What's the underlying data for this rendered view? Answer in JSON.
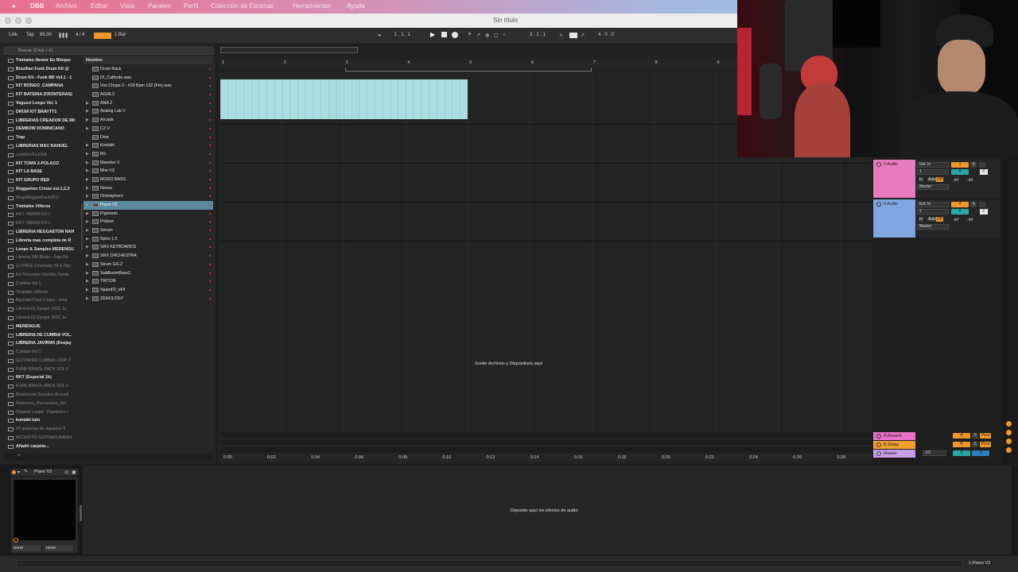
{
  "menubar": {
    "items": [
      "Archivo",
      "Editar",
      "Vista",
      "Paneles",
      "Perfil",
      "Colección de Escenas",
      "Herramientas",
      "Ayuda"
    ]
  },
  "window": {
    "title": "Sin título"
  },
  "transport": {
    "link": "Link",
    "tap": "Tap",
    "tempo": "85.00",
    "time_sig": "4 / 4",
    "quantize": "1 Bar",
    "position": "1 .   1 .   1",
    "loop_start": "3 .   1 .   1",
    "loop_length": "4 .   0 .   0"
  },
  "browser": {
    "search_placeholder": "Buscar (Cmd + F)",
    "sidebar": [
      {
        "label": "Timbales Nestor En Bloque",
        "dim": false
      },
      {
        "label": "Brazilian Funk Drum Kit @",
        "dim": false
      },
      {
        "label": "Drum Kit - Funk BR Vol.1 - 1",
        "dim": false
      },
      {
        "label": "KIT BONGO_CAMPANA",
        "dim": false
      },
      {
        "label": "KIT BATERIA (FRONTERAS)",
        "dim": false
      },
      {
        "label": "Veguzzi Loops Vol. 1",
        "dim": false
      },
      {
        "label": "DRUM KIT BRAYTT1",
        "dim": false
      },
      {
        "label": "LIBRERIAS CREADOR DE RK",
        "dim": false
      },
      {
        "label": "DEMBOW DOMINICANO",
        "dim": false
      },
      {
        "label": "Trap",
        "dim": false
      },
      {
        "label": "LIBRERIAS MAC NAHUEL",
        "dim": false
      },
      {
        "label": "cumbiaVILLERA",
        "dim": true
      },
      {
        "label": "KIT TOMA 2-POLACO",
        "dim": false
      },
      {
        "label": "KIT LA BASE",
        "dim": false
      },
      {
        "label": "KIT GRUPO RED",
        "dim": false
      },
      {
        "label": "Reggaeton Crivas vol.1,2,3",
        "dim": false
      },
      {
        "label": "MegaReggaePack2017",
        "dim": true
      },
      {
        "label": "Timbales Villeros",
        "dim": false
      },
      {
        "label": "RKT -REMIX-DJ-1",
        "dim": true
      },
      {
        "label": "RKT -REMIX-DJ-1",
        "dim": true
      },
      {
        "label": "LIBRERIA REGGAETON NAH",
        "dim": false
      },
      {
        "label": "Libreria mas completa de R",
        "dim": false
      },
      {
        "label": "Loops & Samples MERENGU",
        "dim": false
      },
      {
        "label": "Libreria 188 Beats - Rap-Bo",
        "dim": true
      },
      {
        "label": "12 FREE Cinematic SFX Opc",
        "dim": true
      },
      {
        "label": "Kit Percusion Cumbia Santa",
        "dim": true
      },
      {
        "label": "Cumbia Vol 1",
        "dim": true
      },
      {
        "label": "Timbales Villeros",
        "dim": true
      },
      {
        "label": "Bachata Pack Loops - Joris",
        "dim": true
      },
      {
        "label": "Libreria Dj Danger 2021 Ju",
        "dim": true
      },
      {
        "label": "Libreria Dj Danger 2021 Ju",
        "dim": true
      },
      {
        "label": "MERENGUE",
        "dim": false
      },
      {
        "label": "LIBRERIA DE CUMBIA VOL.",
        "dim": false
      },
      {
        "label": "LIBRERIA JAVIRMX (Deejay",
        "dim": false
      },
      {
        "label": "Cumbia Vol 1",
        "dim": true
      },
      {
        "label": "GUITARRA CUMBIA LOOP 2",
        "dim": true
      },
      {
        "label": "FUNK BRAZIL PACK VOL II",
        "dim": true
      },
      {
        "label": "RKT (Especial 1k)",
        "dim": false
      },
      {
        "label": "FUNK BRAZIL PACK VOL II",
        "dim": true
      },
      {
        "label": "Blackwood Samples Acousti",
        "dim": true
      },
      {
        "label": "Flamenco_Percussion_Vol.",
        "dim": true
      },
      {
        "label": "Organic Loops - Flamenco I",
        "dim": true
      },
      {
        "label": "kontakt tuto",
        "dim": false
      },
      {
        "label": "02 guitarras de regaeton 9",
        "dim": true
      },
      {
        "label": "ACOUSTIC-GUITARS-BANDI",
        "dim": true
      },
      {
        "label": "Añadir carpeta...",
        "dim": false
      }
    ],
    "content_header": "Nombre",
    "content": [
      {
        "label": "Drum Rack",
        "arrow": false,
        "dot": false
      },
      {
        "label": "DI_Cathode.wav",
        "arrow": false,
        "dot": false
      },
      {
        "label": "Vox Chops 2 - #29 Bpm 132 (Fm).wav",
        "arrow": false,
        "dot": false
      },
      {
        "label": "AGML2",
        "arrow": false,
        "dot": false
      },
      {
        "label": "ANA 2",
        "arrow": true,
        "dot": false
      },
      {
        "label": "Analog Lab V",
        "arrow": true,
        "dot": false
      },
      {
        "label": "Arcade",
        "arrow": true,
        "dot": false
      },
      {
        "label": "CZ V",
        "arrow": true,
        "dot": false
      },
      {
        "label": "Diva",
        "arrow": false,
        "dot": false
      },
      {
        "label": "Kontakt",
        "arrow": true,
        "dot": false
      },
      {
        "label": "M1",
        "arrow": true,
        "dot": false
      },
      {
        "label": "Massive X",
        "arrow": true,
        "dot": false
      },
      {
        "label": "Mini V3",
        "arrow": true,
        "dot": false
      },
      {
        "label": "MODO BASS",
        "arrow": true,
        "dot": false
      },
      {
        "label": "Nexus",
        "arrow": true,
        "dot": false
      },
      {
        "label": "Omnisphere",
        "arrow": true,
        "dot": false
      },
      {
        "label": "Piano V2",
        "arrow": true,
        "dot": false,
        "selected": true
      },
      {
        "label": "Pigments",
        "arrow": true,
        "dot": false
      },
      {
        "label": "Polizen",
        "arrow": true,
        "dot": false
      },
      {
        "label": "Serum",
        "arrow": true,
        "dot": false
      },
      {
        "label": "Spire-1.5",
        "arrow": true,
        "dot": false
      },
      {
        "label": "SRX KEYBOARDS",
        "arrow": true,
        "dot": false
      },
      {
        "label": "SRX ORCHESTRA",
        "arrow": true,
        "dot": false
      },
      {
        "label": "Strum GS-2",
        "arrow": true,
        "dot": true
      },
      {
        "label": "SubBoomBass2",
        "arrow": true,
        "dot": false
      },
      {
        "label": "TRITON",
        "arrow": true,
        "dot": false
      },
      {
        "label": "Xpand!2_x64",
        "arrow": true,
        "dot": false
      },
      {
        "label": "ZENOLOGY",
        "arrow": true,
        "dot": false
      }
    ]
  },
  "arrangement": {
    "bars": [
      "1",
      "2",
      "3",
      "4",
      "5",
      "6",
      "7",
      "8",
      "9"
    ],
    "drop_text": "Suelte Archivos y Dispositivos aquí",
    "times": [
      "0:00",
      "0:02",
      "0:04",
      "0:06",
      "0:08",
      "0:10",
      "0:12",
      "0:14",
      "0:16",
      "0:18",
      "0:20",
      "0:22",
      "0:24",
      "0:26",
      "0:28"
    ],
    "clip_color": "#a9dde0"
  },
  "mixer": {
    "tracks": [
      {
        "name": "3 Audio",
        "color": "#e87ac0",
        "input": "Ext. In",
        "channel": "1",
        "num": "3",
        "monitor": [
          "In",
          "Auto",
          "Off"
        ],
        "vol": [
          "-inf",
          "-inf"
        ],
        "pan": "C",
        "output": "Master"
      },
      {
        "name": "4 Audio",
        "color": "#7fa6e0",
        "input": "Ext. In",
        "channel": "2",
        "num": "4",
        "monitor": [
          "In",
          "Auto",
          "Off"
        ],
        "vol": [
          "-inf",
          "-inf"
        ],
        "pan": "C",
        "output": "Master"
      }
    ],
    "returns": [
      {
        "name": "A Reverb",
        "color": "#e870c8",
        "letter": "A",
        "post": "Post"
      },
      {
        "name": "B Delay",
        "color": "#f0a030",
        "letter": "B",
        "post": "Post"
      },
      {
        "name": "Master",
        "color": "#c89ee8",
        "letter": "",
        "post": "",
        "ratio": "1/2"
      }
    ],
    "solo_label": "S",
    "zero": "0"
  },
  "device": {
    "title": "Piano V2",
    "selectors": [
      "none",
      "none"
    ],
    "fx_drop_text": "Deposite aquí los efectos de audio"
  },
  "status": {
    "track": "1-Piano V2"
  }
}
